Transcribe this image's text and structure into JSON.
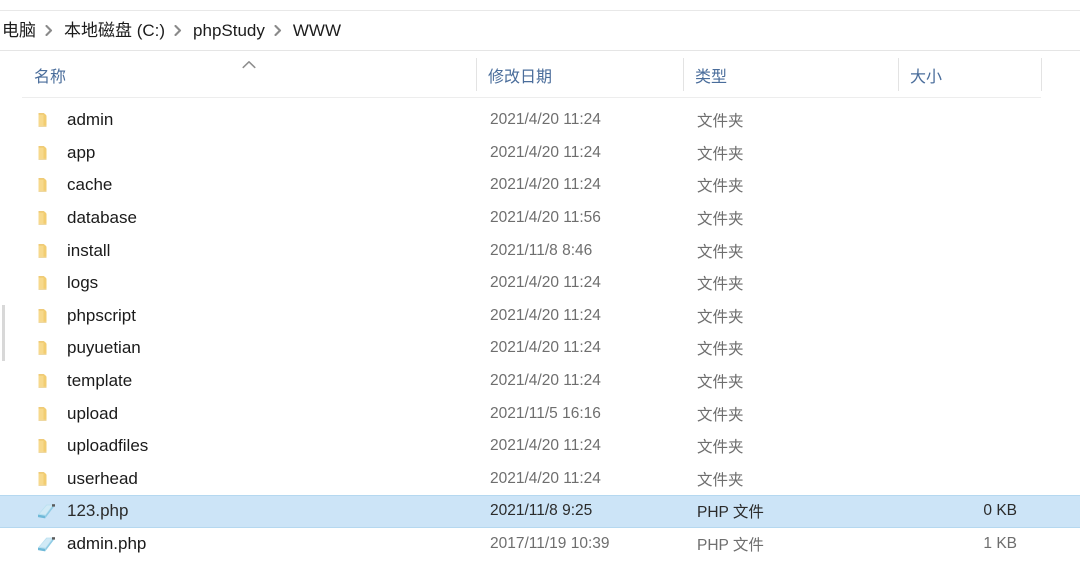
{
  "window": {
    "title": "WWW"
  },
  "breadcrumb": {
    "separator_icon": "chevron-right-icon",
    "items": [
      {
        "label": "电脑"
      },
      {
        "label": "本地磁盘 (C:)"
      },
      {
        "label": "phpStudy"
      },
      {
        "label": "WWW"
      }
    ]
  },
  "columns": {
    "name": {
      "label": "名称",
      "sort": "ascending",
      "sort_icon": "caret-up-icon"
    },
    "date": {
      "label": "修改日期"
    },
    "type": {
      "label": "类型"
    },
    "size": {
      "label": "大小"
    }
  },
  "colors": {
    "selection": "#cce4f7",
    "selection_border": "#b5d8f0",
    "header_text": "#4a6d9b",
    "folder_icon": "#f5d27e",
    "php_icon": "#9fd4ea"
  },
  "files": [
    {
      "name": "admin",
      "icon": "folder-icon",
      "date": "2021/4/20 11:24",
      "type": "文件夹",
      "size": "",
      "selected": false
    },
    {
      "name": "app",
      "icon": "folder-icon",
      "date": "2021/4/20 11:24",
      "type": "文件夹",
      "size": "",
      "selected": false
    },
    {
      "name": "cache",
      "icon": "folder-icon",
      "date": "2021/4/20 11:24",
      "type": "文件夹",
      "size": "",
      "selected": false
    },
    {
      "name": "database",
      "icon": "folder-icon",
      "date": "2021/4/20 11:56",
      "type": "文件夹",
      "size": "",
      "selected": false
    },
    {
      "name": "install",
      "icon": "folder-icon",
      "date": "2021/11/8 8:46",
      "type": "文件夹",
      "size": "",
      "selected": false
    },
    {
      "name": "logs",
      "icon": "folder-icon",
      "date": "2021/4/20 11:24",
      "type": "文件夹",
      "size": "",
      "selected": false
    },
    {
      "name": "phpscript",
      "icon": "folder-icon",
      "date": "2021/4/20 11:24",
      "type": "文件夹",
      "size": "",
      "selected": false
    },
    {
      "name": "puyuetian",
      "icon": "folder-icon",
      "date": "2021/4/20 11:24",
      "type": "文件夹",
      "size": "",
      "selected": false
    },
    {
      "name": "template",
      "icon": "folder-icon",
      "date": "2021/4/20 11:24",
      "type": "文件夹",
      "size": "",
      "selected": false
    },
    {
      "name": "upload",
      "icon": "folder-icon",
      "date": "2021/11/5 16:16",
      "type": "文件夹",
      "size": "",
      "selected": false
    },
    {
      "name": "uploadfiles",
      "icon": "folder-icon",
      "date": "2021/4/20 11:24",
      "type": "文件夹",
      "size": "",
      "selected": false
    },
    {
      "name": "userhead",
      "icon": "folder-icon",
      "date": "2021/4/20 11:24",
      "type": "文件夹",
      "size": "",
      "selected": false
    },
    {
      "name": "123.php",
      "icon": "php-file-icon",
      "date": "2021/11/8 9:25",
      "type": "PHP 文件",
      "size": "0 KB",
      "selected": true
    },
    {
      "name": "admin.php",
      "icon": "php-file-icon",
      "date": "2017/11/19 10:39",
      "type": "PHP 文件",
      "size": "1 KB",
      "selected": false
    }
  ]
}
